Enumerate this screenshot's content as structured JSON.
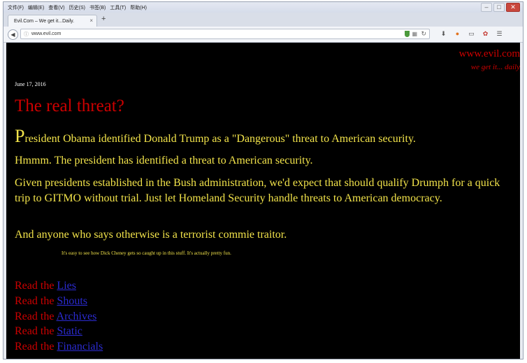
{
  "menu": [
    "文件(F)",
    "编辑(E)",
    "查看(V)",
    "历史(S)",
    "书签(B)",
    "工具(T)",
    "帮助(H)"
  ],
  "window_controls": {
    "minimize": "–",
    "maximize": "□",
    "close": "✕"
  },
  "tab": {
    "title": "Evil.Com – We get it...Daily.",
    "close": "×"
  },
  "new_tab": "+",
  "address": {
    "url": "www.evil.com"
  },
  "page": {
    "site_name": "www.evil.com",
    "tagline": "we get it... daily",
    "date": "June 17, 2016",
    "title": "The real threat?",
    "p1_dropcap": "P",
    "p1_rest": "resident Obama identified Donald Trump as a \"Dangerous\" threat to American security.",
    "p2": "Hmmm. The president has identified a threat to American security.",
    "p3": "Given presidents established in the Bush administration, we'd expect that should qualify Drumph for a quick trip to GITMO without trial. Just let Homeland Security handle threats to American democracy.",
    "p4": "And anyone who says otherwise is a terrorist commie traitor.",
    "footnote": "It's easy to see how Dick Cheney gets so caught up in this stuff.  It's actually pretty fun.",
    "read_prefix": "Read the ",
    "links": [
      "Lies",
      "Shouts",
      "Archives",
      "Static",
      "Financials"
    ]
  },
  "colors": {
    "background": "#000000",
    "accent_red": "#cc0000",
    "text_yellow": "#f2e34a",
    "link_blue": "#2b2bd1"
  }
}
